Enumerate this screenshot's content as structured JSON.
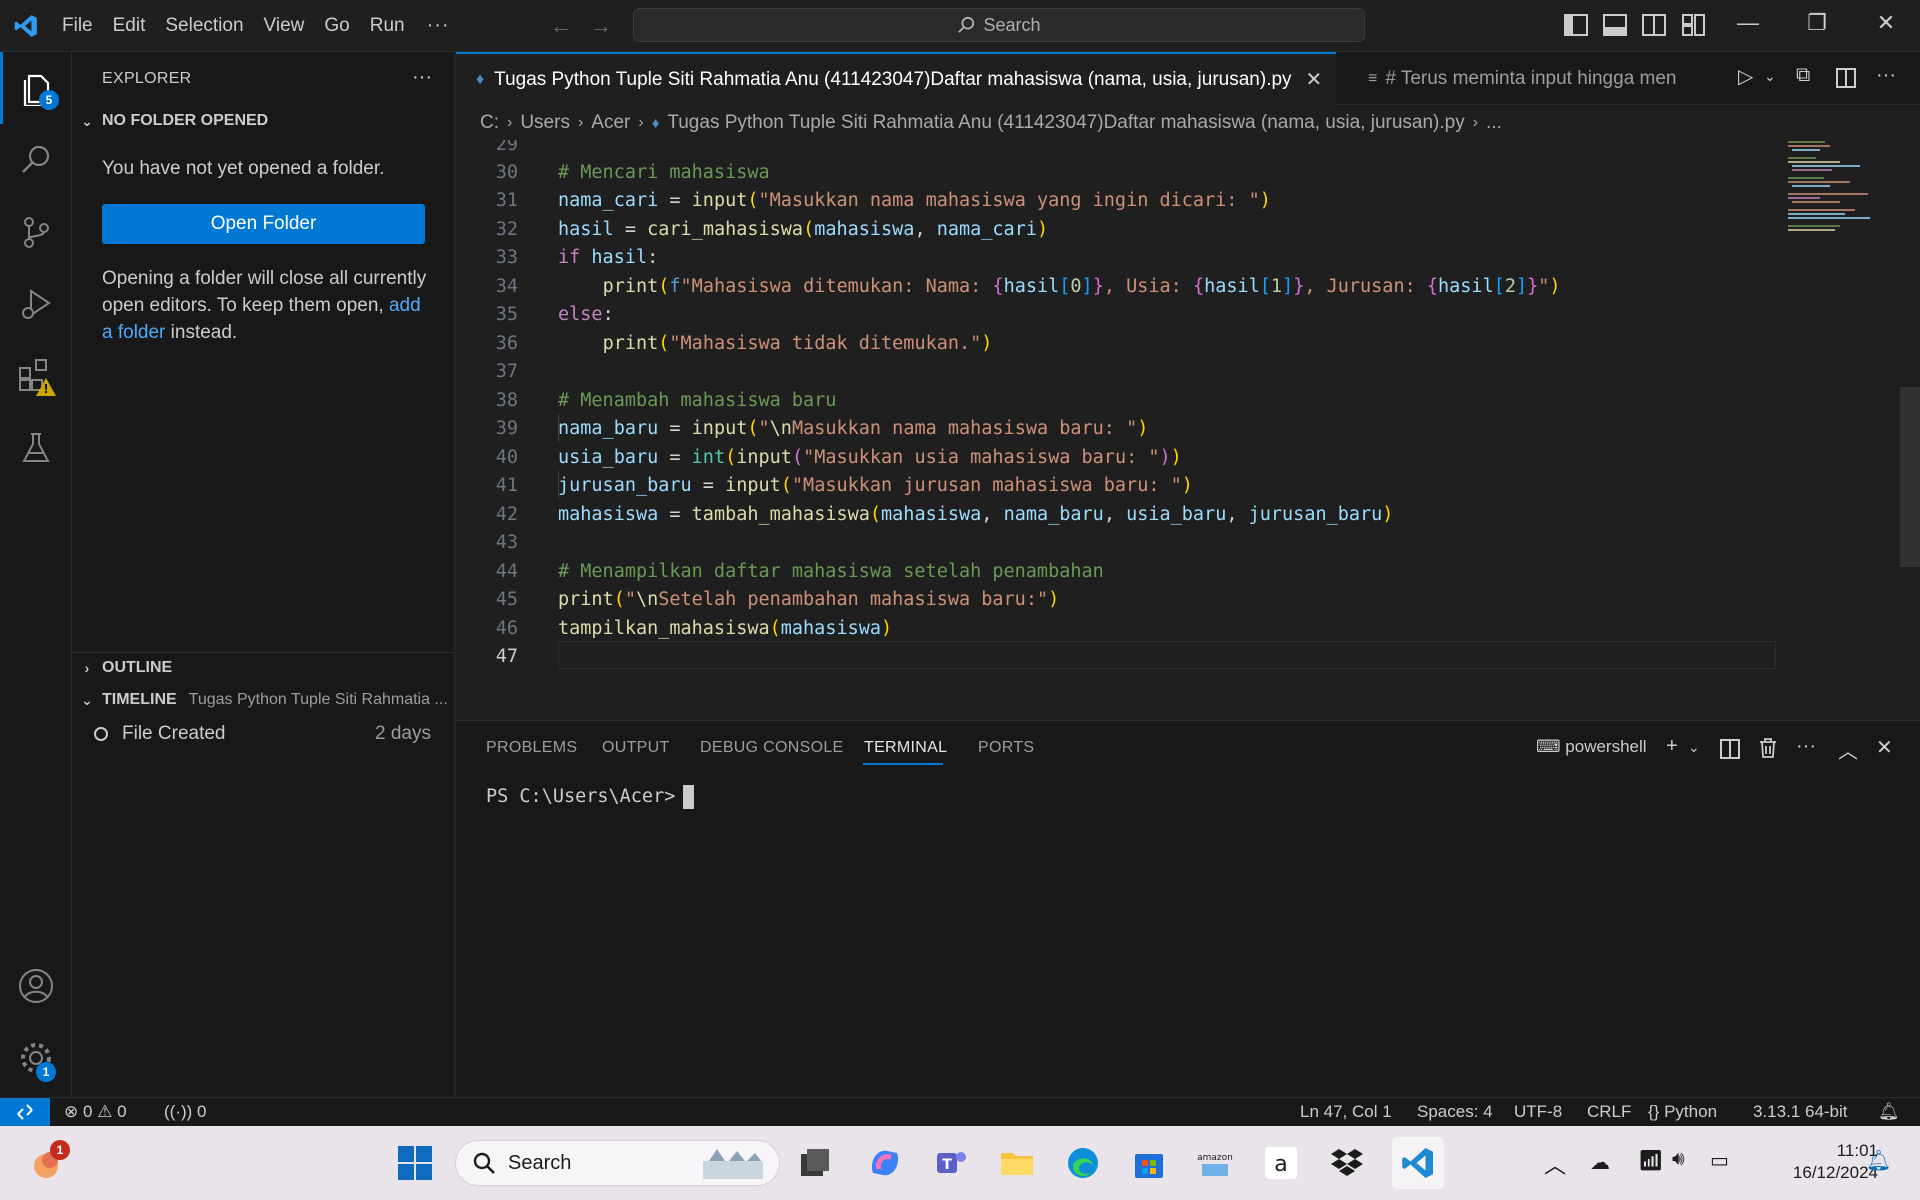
{
  "menu": [
    "File",
    "Edit",
    "Selection",
    "View",
    "Go",
    "Run"
  ],
  "menu_more": "···",
  "search": {
    "label": "Search"
  },
  "activity": {
    "explorer_badge": "5",
    "settings_badge": "1"
  },
  "sidebar": {
    "header": "EXPLORER",
    "no_folder_title": "NO FOLDER OPENED",
    "no_folder_msg": "You have not yet opened a folder.",
    "open_folder_label": "Open Folder",
    "note_before": "Opening a folder will close all currently open editors. To keep them open, ",
    "note_link": "add a folder",
    "note_after": " instead.",
    "outline_title": "OUTLINE",
    "timeline_title": "TIMELINE",
    "timeline_file": "Tugas Python Tuple Siti Rahmatia ...",
    "timeline_item": "File Created",
    "timeline_item_time": "2 days"
  },
  "tabs": {
    "active_label": "Tugas Python Tuple Siti Rahmatia Anu (411423047)Daftar mahasiswa (nama, usia, jurusan).py",
    "second_label": "# Terus meminta input hingga mendap"
  },
  "breadcrumb": [
    "C:",
    "Users",
    "Acer",
    "Tugas Python Tuple Siti Rahmatia Anu (411423047)Daftar mahasiswa (nama, usia, jurusan).py",
    "..."
  ],
  "editor": {
    "line_numbers": [
      "29",
      "30",
      "31",
      "32",
      "33",
      "34",
      "35",
      "36",
      "37",
      "38",
      "39",
      "40",
      "41",
      "42",
      "43",
      "44",
      "45",
      "46",
      "47"
    ]
  },
  "panel": {
    "tabs": [
      "PROBLEMS",
      "OUTPUT",
      "DEBUG CONSOLE",
      "TERMINAL",
      "PORTS"
    ],
    "shell": "powershell",
    "prompt": "PS C:\\Users\\Acer>"
  },
  "status": {
    "errors": "0",
    "warnings": "0",
    "ports": "0",
    "position": "Ln 47, Col 1",
    "spaces": "Spaces: 4",
    "encoding": "UTF-8",
    "eol": "CRLF",
    "language": "Python",
    "interpreter": "3.13.1 64-bit"
  },
  "taskbar": {
    "search_label": "Search",
    "widget_badge": "1",
    "time": "11:01",
    "date": "16/12/2024"
  },
  "colors": {
    "accent": "#0078d4",
    "warning": "#cca700"
  }
}
